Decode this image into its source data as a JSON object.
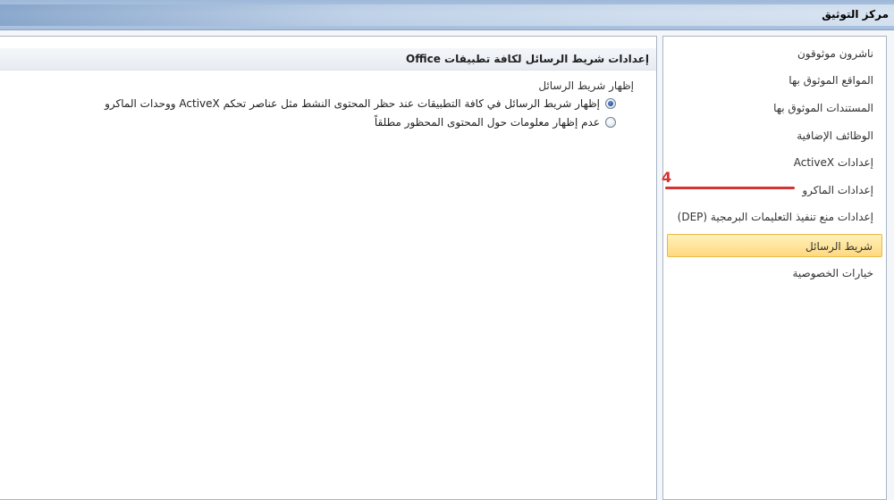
{
  "window": {
    "title": "مركز التوثيق"
  },
  "nav": {
    "items": [
      {
        "label": "ناشرون موثوقون"
      },
      {
        "label": "المواقع الموثوق بها"
      },
      {
        "label": "المستندات الموثوق بها"
      },
      {
        "label": "الوظائف الإضافية"
      },
      {
        "label": "إعدادات ActiveX"
      },
      {
        "label": "إعدادات الماكرو"
      },
      {
        "label": "إعدادات منع تنفيذ التعليمات البرمجية (DEP)"
      },
      {
        "label": "شريط الرسائل"
      },
      {
        "label": "خيارات الخصوصية"
      }
    ],
    "selected_index": 7
  },
  "main": {
    "section_title": "إعدادات شريط الرسائل لكافة تطبيقات Office",
    "group_label": "إظهار شريط الرسائل",
    "options": [
      {
        "label": "إظهار شريط الرسائل في كافة التطبيقات عند حظر المحتوى النشط مثل عناصر تحكم ActiveX ووحدات الماكرو",
        "checked": true
      },
      {
        "label": "عدم إظهار معلومات حول المحتوى المحظور مطلقاً",
        "checked": false
      }
    ]
  },
  "annotation": {
    "number": "4",
    "color": "#d63232"
  },
  "colors": {
    "selected_item_bg": "#ffd980",
    "panel_border": "#a9b6c6"
  }
}
